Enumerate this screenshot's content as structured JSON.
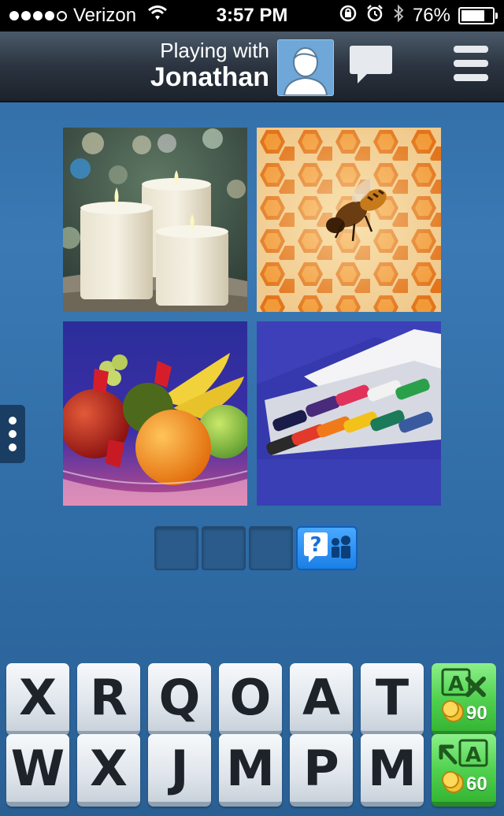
{
  "status_bar": {
    "carrier": "Verizon",
    "time": "3:57 PM",
    "battery_percent": "76%",
    "battery_level": 0.76,
    "signal_bars_filled": 4,
    "signal_bars_total": 5
  },
  "header": {
    "playing_label": "Playing with",
    "opponent_name": "Jonathan"
  },
  "puzzle": {
    "images": [
      "candles-image",
      "honeycomb-bee-image",
      "fruit-bowl-image",
      "crayons-image"
    ],
    "answer_slots": 3
  },
  "keyboard": {
    "row1": [
      "X",
      "R",
      "Q",
      "O",
      "A",
      "T"
    ],
    "row2": [
      "W",
      "X",
      "J",
      "M",
      "P",
      "M"
    ],
    "remove_letter_cost": "90",
    "reveal_letter_cost": "60"
  },
  "colors": {
    "background": "#3a79b4",
    "power_green": "#4fd04d",
    "hint_blue": "#1a7fe6"
  }
}
